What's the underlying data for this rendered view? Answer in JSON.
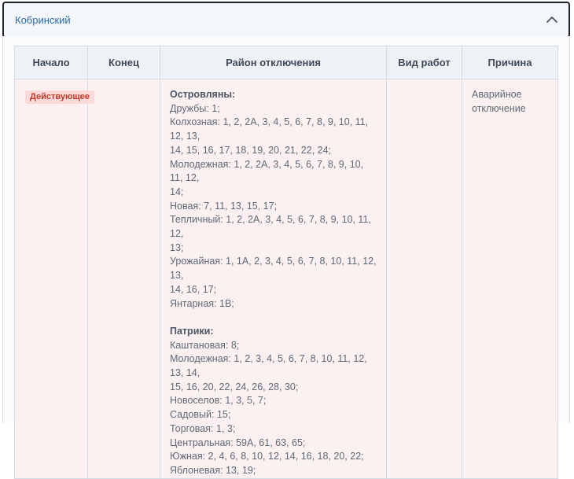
{
  "accordion": {
    "title": "Кобринский"
  },
  "table": {
    "headers": [
      "Начало",
      "Конец",
      "Район отключения",
      "Вид работ",
      "Причина"
    ],
    "row": {
      "start": "",
      "status_badge": "Действующее",
      "end": "",
      "work_type": "",
      "reason": "Аварийное отключение",
      "areas": [
        {
          "title": "Островляны:",
          "lines": [
            "Дружбы: 1;",
            "Колхозная: 1, 2, 2А, 3, 4, 5, 6, 7, 8, 9, 10, 11, 12, 13,",
            "14, 15, 16, 17, 18, 19, 20, 21, 22, 24;",
            "Молодежная: 1, 2, 2А, 3, 4, 5, 6, 7, 8, 9, 10, 11, 12,",
            "14;",
            "Новая: 7, 11, 13, 15, 17;",
            "Тепличный: 1, 2, 2А, 3, 4, 5, 6, 7, 8, 9, 10, 11, 12,",
            "13;",
            "Урожайная: 1, 1А, 2, 3, 4, 5, 6, 7, 8, 10, 11, 12, 13,",
            "14, 16, 17;",
            "Янтарная: 1В;"
          ]
        },
        {
          "title": "Патрики:",
          "lines": [
            "Каштановая: 8;",
            "Молодежная: 1, 2, 3, 4, 5, 6, 7, 8, 10, 11, 12, 13, 14,",
            "15, 16, 20, 22, 24, 26, 28, 30;",
            "Новоселов: 1, 3, 5, 7;",
            "Садовый: 15;",
            "Торговая: 1, 3;",
            "Центральная: 59А, 61, 63, 65;",
            "Южная: 2, 4, 6, 8, 10, 12, 14, 16, 18, 20, 22;",
            "Яблоневая: 13, 19;"
          ]
        }
      ]
    }
  }
}
